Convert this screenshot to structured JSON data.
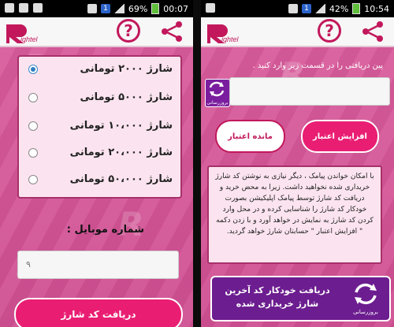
{
  "left_screen": {
    "statusbar": {
      "sim": "1",
      "battery": "69%",
      "time": "00:07"
    },
    "app": {
      "help_symbol": "?",
      "logo_text": "ightel"
    },
    "options": [
      {
        "label": "شارژ ۲۰۰۰ تومانی",
        "selected": true
      },
      {
        "label": "شارژ ۵۰۰۰ تومانی",
        "selected": false
      },
      {
        "label": "شارژ ۱۰،۰۰۰ تومانی",
        "selected": false
      },
      {
        "label": "شارژ ۲۰،۰۰۰ تومانی",
        "selected": false
      },
      {
        "label": "شارژ ۵۰،۰۰۰ تومانی",
        "selected": false
      }
    ],
    "mobile_label": "شماره موبایل :",
    "mobile_input": {
      "value": "",
      "placeholder": "٩"
    },
    "submit_label": "دریافت کد شارژ"
  },
  "right_screen": {
    "statusbar": {
      "sim": "1",
      "battery": "42%",
      "time": "10:54"
    },
    "app": {
      "help_symbol": "?",
      "logo_text": "ightel"
    },
    "instruction": "پین دریافتی را در قسمت زیر وارد کنید .",
    "code_input": {
      "value": "",
      "placeholder": ""
    },
    "refresh_small_label": "بروزرسانی",
    "balance_button": "مانده اعتبار",
    "increase_button": "افزایش اعتبار",
    "info_text": "با امکان خواندن پیامک ، دیگر نیازی به نوشتن کد شارژ خریداری شده نخواهید داشت. زیرا به محض خرید و دریافت کد شارژ توسط پیامک اپلیکیشن بصورت خودکار کد شارژ را شناسایی کرده و در محل وارد کردن کد شارژ به نمایش در خواهد آورد و با زدن دکمه \" افزایش اعتبار \" حسابتان شارژ خواهد گردید.",
    "last_code_button": "دریافت خودکار کد آخرین شارژ خریداری شده",
    "last_code_icon_label": "بروزرسانی"
  },
  "colors": {
    "accent": "#e91e73",
    "brand": "#c2185b",
    "purple": "#6c1d8f",
    "panel": "#fbe4ef"
  }
}
